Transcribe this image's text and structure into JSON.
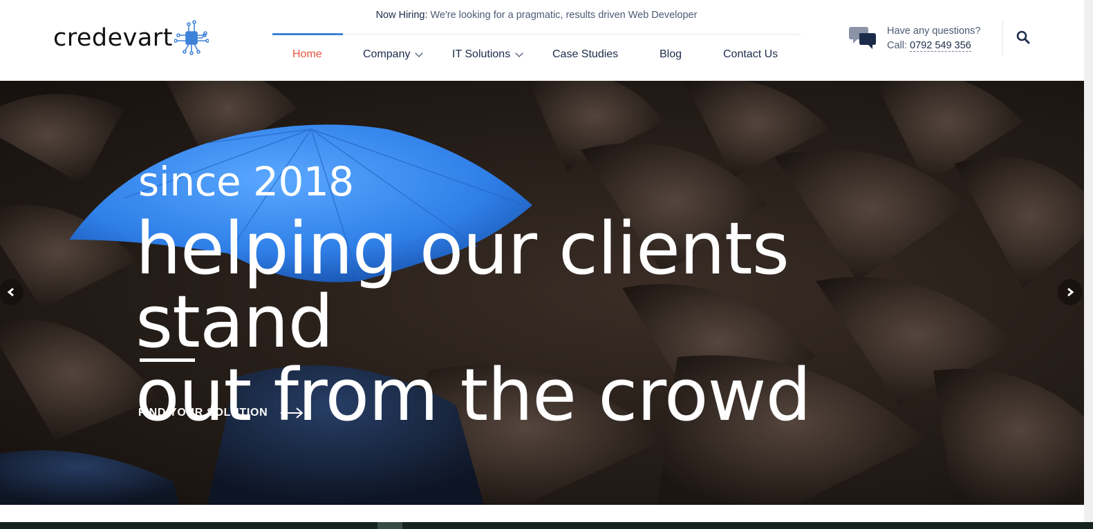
{
  "brand": {
    "logo_text": "credevart",
    "logo_icon": "circuit-chip-icon",
    "accent": "#3b82d8"
  },
  "top_bar": {
    "hiring_label": "Now Hiring:",
    "hiring_text": "We're looking for a pragmatic, results driven Web Developer"
  },
  "nav": {
    "items": [
      {
        "label": "Home",
        "active": true,
        "has_dropdown": false
      },
      {
        "label": "Company",
        "active": false,
        "has_dropdown": true
      },
      {
        "label": "IT Solutions",
        "active": false,
        "has_dropdown": true
      },
      {
        "label": "Case Studies",
        "active": false,
        "has_dropdown": false
      },
      {
        "label": "Blog",
        "active": false,
        "has_dropdown": false
      },
      {
        "label": "Contact Us",
        "active": false,
        "has_dropdown": false
      }
    ],
    "active_color": "#e8553d"
  },
  "contact": {
    "question": "Have any questions?",
    "call_label": "Call:",
    "phone": "0792 549 356",
    "icon": "chat-bubbles-icon"
  },
  "search": {
    "icon": "search-icon"
  },
  "hero": {
    "subtitle": "since 2018",
    "title_line1": "helping our clients stand",
    "title_line2": "out from the crowd",
    "cta_label": "FIND YOUR SOLUTION",
    "cta_icon": "arrow-right-icon",
    "prev_icon": "chevron-left-icon",
    "next_icon": "chevron-right-icon",
    "highlight_color": "#3a8bf0"
  }
}
